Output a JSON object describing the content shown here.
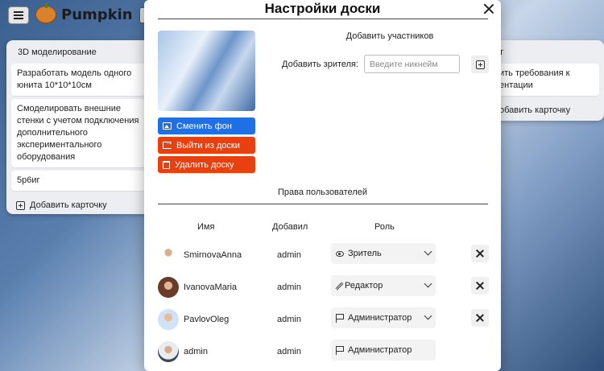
{
  "app": {
    "logo_text": "Pumpkin"
  },
  "board": {
    "left_column": {
      "title": "3D моделирование",
      "cards": [
        "Разработать модель одного юнита 10*10*10см",
        "Смоделировать внешние стенки с учетом подключения дополнительного экспериментального оборудования",
        "5р6иг"
      ],
      "add_card_label": "Добавить карточку"
    },
    "right_column": {
      "title": "т",
      "cards": [
        "ить требования к ентации"
      ],
      "add_card_label": "обавить карточку"
    }
  },
  "modal": {
    "title": "Настройки доски",
    "buttons": {
      "change_bg": "Сменить фон",
      "leave_board": "Выйти из доски",
      "delete_board": "Удалить доску"
    },
    "add_members_title": "Добавить участников",
    "add_viewer_label": "Добавить зрителя:",
    "nickname_placeholder": "Введите никнейм",
    "rights_title": "Права пользователей",
    "table_headers": {
      "name": "Имя",
      "added_by": "Добавил",
      "role": "Роль"
    },
    "users": [
      {
        "name": "SmirnovaAnna",
        "added_by": "admin",
        "role": "Зритель",
        "role_icon": "eye-icon",
        "editable": true
      },
      {
        "name": "IvanovaMaria",
        "added_by": "admin",
        "role": "Редактор",
        "role_icon": "pencil-icon",
        "editable": true
      },
      {
        "name": "PavlovOleg",
        "added_by": "admin",
        "role": "Администратор",
        "role_icon": "flag-icon",
        "editable": true
      },
      {
        "name": "admin",
        "added_by": "admin",
        "role": "Администратор",
        "role_icon": "flag-icon",
        "editable": false
      }
    ]
  },
  "colors": {
    "primary": "#1f6fe5",
    "danger": "#e8400e"
  }
}
